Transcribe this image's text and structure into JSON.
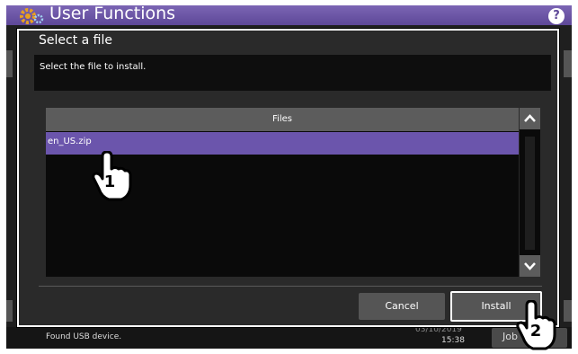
{
  "header": {
    "title": "User Functions",
    "help_icon": "?"
  },
  "dialog": {
    "title": "Select a file",
    "instruction": "Select the file to install.",
    "file_list": {
      "header": "Files",
      "items": [
        "en_US.zip"
      ],
      "selected_index": 0
    },
    "buttons": {
      "cancel": "Cancel",
      "install": "Install"
    }
  },
  "status_bar": {
    "message": "Found USB device.",
    "date": "03/10/2019",
    "time": "15:38",
    "job_button": "Job"
  },
  "callouts": {
    "step1": "1",
    "step2": "2"
  },
  "colors": {
    "header": "#5e4898",
    "selection": "#6b55ac"
  }
}
